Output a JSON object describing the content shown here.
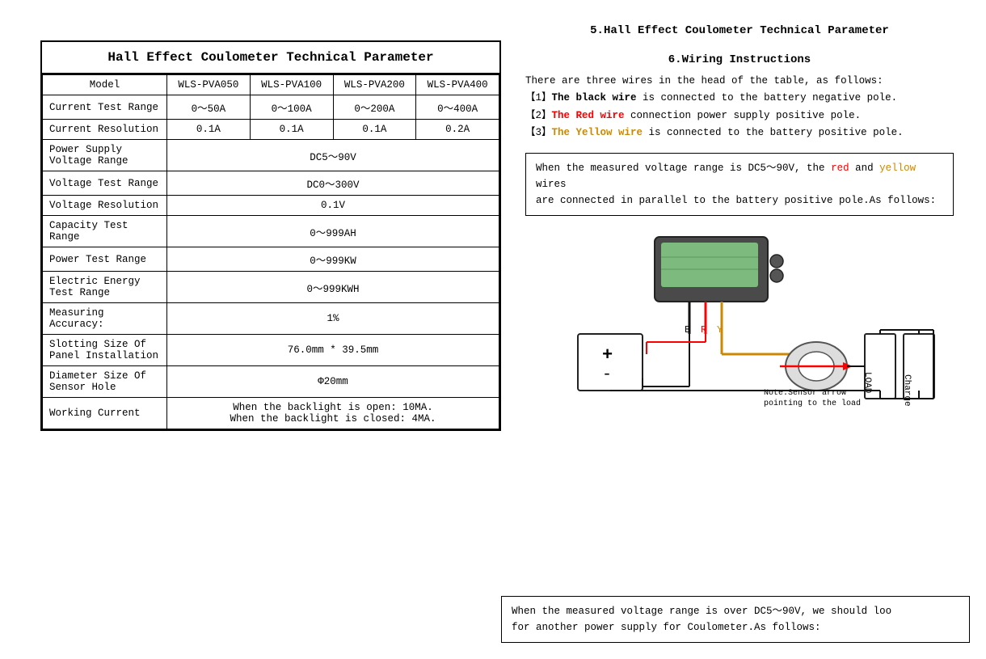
{
  "left": {
    "table_title": "Hall Effect Coulometer Technical Parameter",
    "headers": [
      "Model",
      "WLS-PVA050",
      "WLS-PVA100",
      "WLS-PVA200",
      "WLS-PVA400"
    ],
    "rows": [
      {
        "label": "Current Test Range",
        "values": [
          "0～50A",
          "0～100A",
          "0～200A",
          "0～400A"
        ],
        "span": false
      },
      {
        "label": "Current Resolution",
        "values": [
          "0.1A",
          "0.1A",
          "0.1A",
          "0.2A"
        ],
        "span": false
      },
      {
        "label": "Power Supply Voltage Range",
        "values": [
          "DC5～90V"
        ],
        "span": true
      },
      {
        "label": "Voltage Test Range",
        "values": [
          "DC0～300V"
        ],
        "span": true
      },
      {
        "label": "Voltage Resolution",
        "values": [
          "0.1V"
        ],
        "span": true
      },
      {
        "label": "Capacity Test Range",
        "values": [
          "0～999AH"
        ],
        "span": true
      },
      {
        "label": "Power Test Range",
        "values": [
          "0～999KW"
        ],
        "span": true
      },
      {
        "label": "Electric Energy Test Range",
        "values": [
          "0～999KWH"
        ],
        "span": true
      },
      {
        "label": "Measuring Accuracy:",
        "values": [
          "1%"
        ],
        "span": true
      },
      {
        "label": "Slotting Size Of Panel Installation",
        "values": [
          "76.0mm * 39.5mm"
        ],
        "span": true
      },
      {
        "label": "Diameter Size Of Sensor Hole",
        "values": [
          "Φ20mm"
        ],
        "span": true
      },
      {
        "label": "Working Current",
        "values": [
          "When the backlight is open: 10MA.\nWhen the backlight is closed: 4MA."
        ],
        "span": true
      }
    ]
  },
  "right": {
    "section5_title": "5.Hall Effect Coulometer Technical Parameter",
    "section6_title": "6.Wiring Instructions",
    "wiring_intro": "There are three wires in the head of the table, as follows:",
    "wire1_bracket": "【1】",
    "wire1_label": "The black wire",
    "wire1_text": " is connected to the battery negative pole.",
    "wire2_bracket": "【2】",
    "wire2_label": "The Red wire",
    "wire2_text": " connection power supply positive pole.",
    "wire3_bracket": "【3】",
    "wire3_label": "The Yellow wire",
    "wire3_text": " is connected to the battery positive pole.",
    "info_box1_line1": "When the measured voltage range is DC5～90V, the",
    "info_box1_red": "red",
    "info_box1_and": "and",
    "info_box1_yellow": "yellow",
    "info_box1_line1_end": "wires",
    "info_box1_line2": "are connected in parallel to the battery positive pole.As follows:",
    "note_sensor": "Note:Sensor arrow",
    "note_pointing": "pointing to the load",
    "labels": {
      "B": "B",
      "R": "R",
      "Y": "Y",
      "LOAD": "LOAD",
      "Charger": "Charger"
    },
    "info_box2_line1": "When the measured voltage range is over DC5～90V, we should  loo",
    "info_box2_line2": "for another power supply for Coulometer.As follows:"
  }
}
